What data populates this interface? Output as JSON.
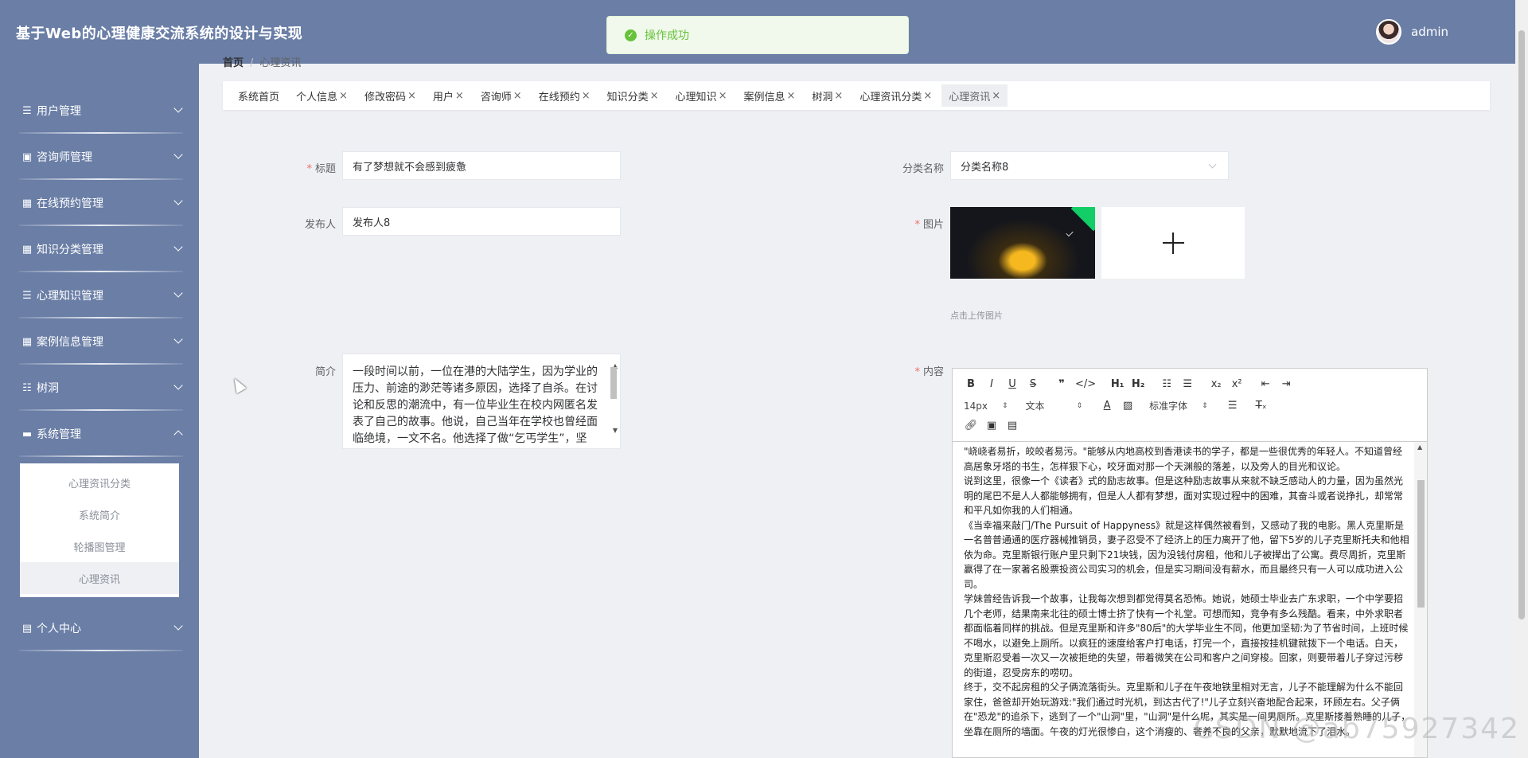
{
  "header": {
    "title": "基于Web的心理健康交流系统的设计与实现",
    "username": "admin"
  },
  "toast": {
    "message": "操作成功"
  },
  "sidebar": {
    "items": [
      {
        "label": "用户管理",
        "icon": "list-icon",
        "glyph": "☰"
      },
      {
        "label": "咨询师管理",
        "icon": "document-icon",
        "glyph": "▣"
      },
      {
        "label": "在线预约管理",
        "icon": "grid-icon",
        "glyph": "▦"
      },
      {
        "label": "知识分类管理",
        "icon": "grid-icon",
        "glyph": "▦"
      },
      {
        "label": "心理知识管理",
        "icon": "list-icon",
        "glyph": "☰"
      },
      {
        "label": "案例信息管理",
        "icon": "grid-icon",
        "glyph": "▦"
      },
      {
        "label": "树洞",
        "icon": "sliders-icon",
        "glyph": "☷"
      },
      {
        "label": "系统管理",
        "icon": "monitor-icon",
        "glyph": "▬"
      }
    ],
    "submenu": [
      "心理资讯分类",
      "系统简介",
      "轮播图管理",
      "心理资讯"
    ],
    "last_item": {
      "label": "个人中心",
      "icon": "calendar-icon",
      "glyph": "▤"
    }
  },
  "breadcrumb": {
    "home": "首页",
    "current": "心理资讯"
  },
  "tabs": [
    {
      "label": "系统首页",
      "closable": false
    },
    {
      "label": "个人信息",
      "closable": true
    },
    {
      "label": "修改密码",
      "closable": true
    },
    {
      "label": "用户",
      "closable": true
    },
    {
      "label": "咨询师",
      "closable": true
    },
    {
      "label": "在线预约",
      "closable": true
    },
    {
      "label": "知识分类",
      "closable": true
    },
    {
      "label": "心理知识",
      "closable": true
    },
    {
      "label": "案例信息",
      "closable": true
    },
    {
      "label": "树洞",
      "closable": true
    },
    {
      "label": "心理资讯分类",
      "closable": true
    },
    {
      "label": "心理资讯",
      "closable": true,
      "active": true
    }
  ],
  "form": {
    "title_label": "标题",
    "title_value": "有了梦想就不会感到疲惫",
    "publisher_label": "发布人",
    "publisher_value": "发布人8",
    "category_label": "分类名称",
    "category_value": "分类名称8",
    "image_label": "图片",
    "upload_tip": "点击上传图片",
    "intro_label": "简介",
    "intro_value": "一段时间以前，一位在港的大陆学生，因为学业的压力、前途的渺茫等诸多原因，选择了自杀。在讨论和反思的潮流中，有一位毕业生在校内网匿名发表了自己的故事。他说，自己当年在学校也曾经面临绝境，一文不名。他选择了做“乞丐学生”，坚",
    "content_label": "内容"
  },
  "editor": {
    "font_size": "14px",
    "block_type": "文本",
    "font_family": "标准字体",
    "paragraphs": [
      "\"峣峣者易折，皎皎者易污。\"能够从内地高校到香港读书的学子，都是一些很优秀的年轻人。不知道曾经高居象牙塔的书生，怎样狠下心，咬牙面对那一个天渊般的落差，以及旁人的目光和议论。",
      "说到这里，很像一个《读者》式的励志故事。但是这种励志故事从来就不缺乏感动人的力量，因为虽然光明的尾巴不是人人都能够拥有，但是人人都有梦想，面对实现过程中的困难，其奋斗或者说挣扎，却常常和平凡如你我的人们相通。",
      "《当幸福来敲门/The Pursuit of Happyness》就是这样偶然被看到，又感动了我的电影。黑人克里斯是一名普普通通的医疗器械推销员，妻子忍受不了经济上的压力离开了他，留下5岁的儿子克里斯托夫和他相依为命。克里斯银行账户里只剩下21块钱，因为没钱付房租，他和儿子被撵出了公寓。费尽周折，克里斯赢得了在一家著名股票投资公司实习的机会，但是实习期间没有薪水，而且最终只有一人可以成功进入公司。",
      "学妹曾经告诉我一个故事，让我每次想到都觉得莫名恐怖。她说，她硕士毕业去广东求职，一个中学要招几个老师，结果南来北往的硕士博士挤了快有一个礼堂。可想而知，竞争有多么残酷。看来，中外求职者都面临着同样的挑战。但是克里斯和许多\"80后\"的大学毕业生不同，他更加坚韧:为了节省时间，上班时候不喝水，以避免上厕所。以疯狂的速度给客户打电话，打完一个，直接按挂机键就拨下一个电话。白天，克里斯忍受着一次又一次被拒绝的失望，带着微笑在公司和客户之间穿梭。回家，则要带着儿子穿过污秽的街道，忍受房东的唠叨。",
      "终于，交不起房租的父子俩流落街头。克里斯和儿子在午夜地铁里相对无言，儿子不能理解为什么不能回家住，爸爸却开始玩游戏:\"我们通过时光机，到达古代了!\"儿子立刻兴奋地配合起来，环顾左右。父子俩在\"恐龙\"的追杀下，逃到了一个\"山洞\"里，\"山洞\"是什么呢，其实是一间男厕所。克里斯搂着熟睡的儿子，坐靠在厕所的墙面。午夜的灯光很惨白，这个消瘦的、奢养不良的父亲，默默地流下了泪水。"
    ]
  },
  "watermark": "CSDN @ab75927342"
}
